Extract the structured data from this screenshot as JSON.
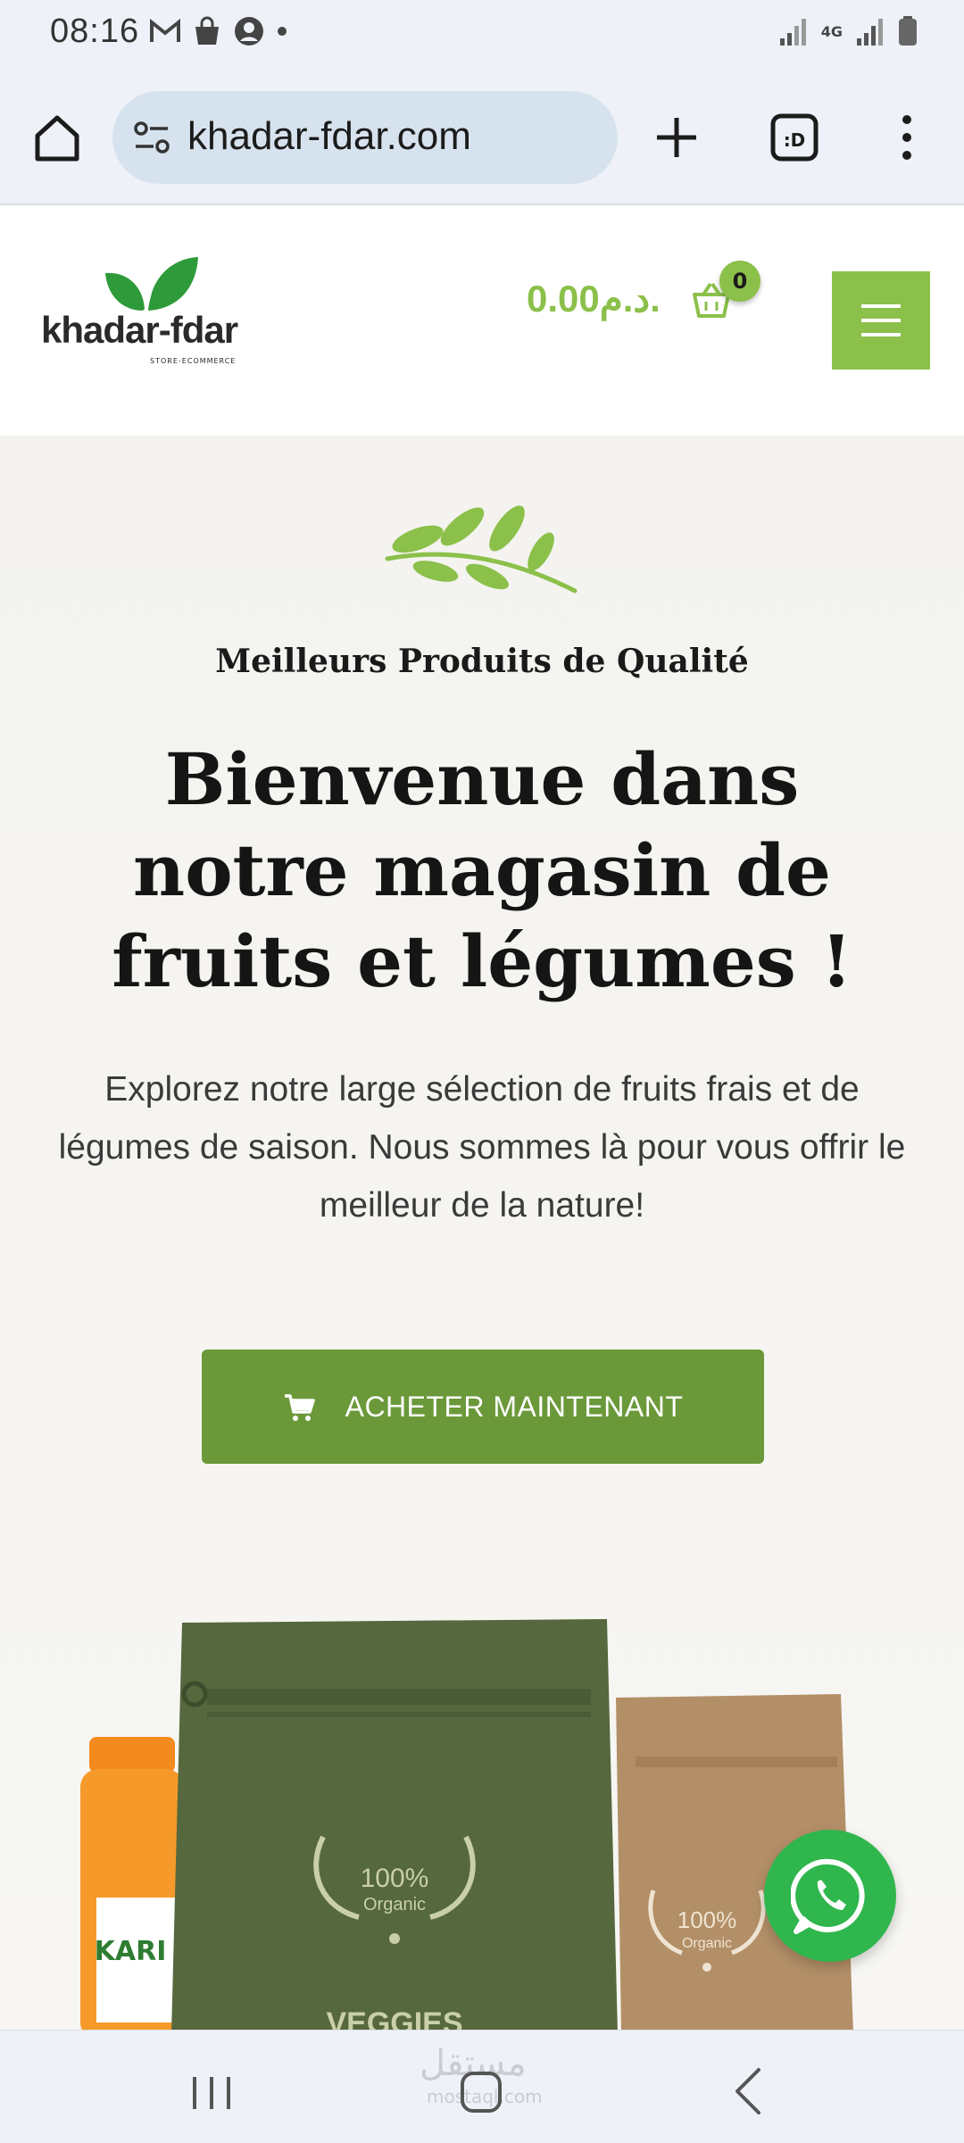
{
  "status_bar": {
    "time": "08:16",
    "network": "4G"
  },
  "browser": {
    "url": "khadar-fdar.com",
    "tab_count_glyph": ":D"
  },
  "site_header": {
    "logo_name": "khadar-fdar",
    "logo_tagline": "STORE-ECOMMERCE",
    "cart_total": "0.00د.م.",
    "cart_count": "0"
  },
  "hero": {
    "kicker": "Meilleurs Produits de Qualité",
    "title": "Bienvenue dans notre magasin de fruits et légumes !",
    "description": "Explorez notre large sélection de fruits frais et de légumes de saison. Nous sommes là pour vous offrir le meilleur de la nature!",
    "cta_label": "ACHETER MAINTENANT"
  },
  "products": {
    "green_bag_badge": "100%",
    "green_bag_badge_sub": "Organic",
    "green_bag_name": "VEGGIES",
    "kraft_bag_badge": "100%",
    "kraft_bag_badge_sub": "Organic",
    "jar_label": "KARI"
  },
  "watermark": {
    "text": "مستقل",
    "sub": "mostaql.com"
  },
  "colors": {
    "brand_green": "#8bc04a",
    "cta_green": "#6b993a",
    "whatsapp_green": "#2fb64d",
    "browser_chrome": "#eef2f8",
    "url_pill": "#d6e3ee"
  }
}
